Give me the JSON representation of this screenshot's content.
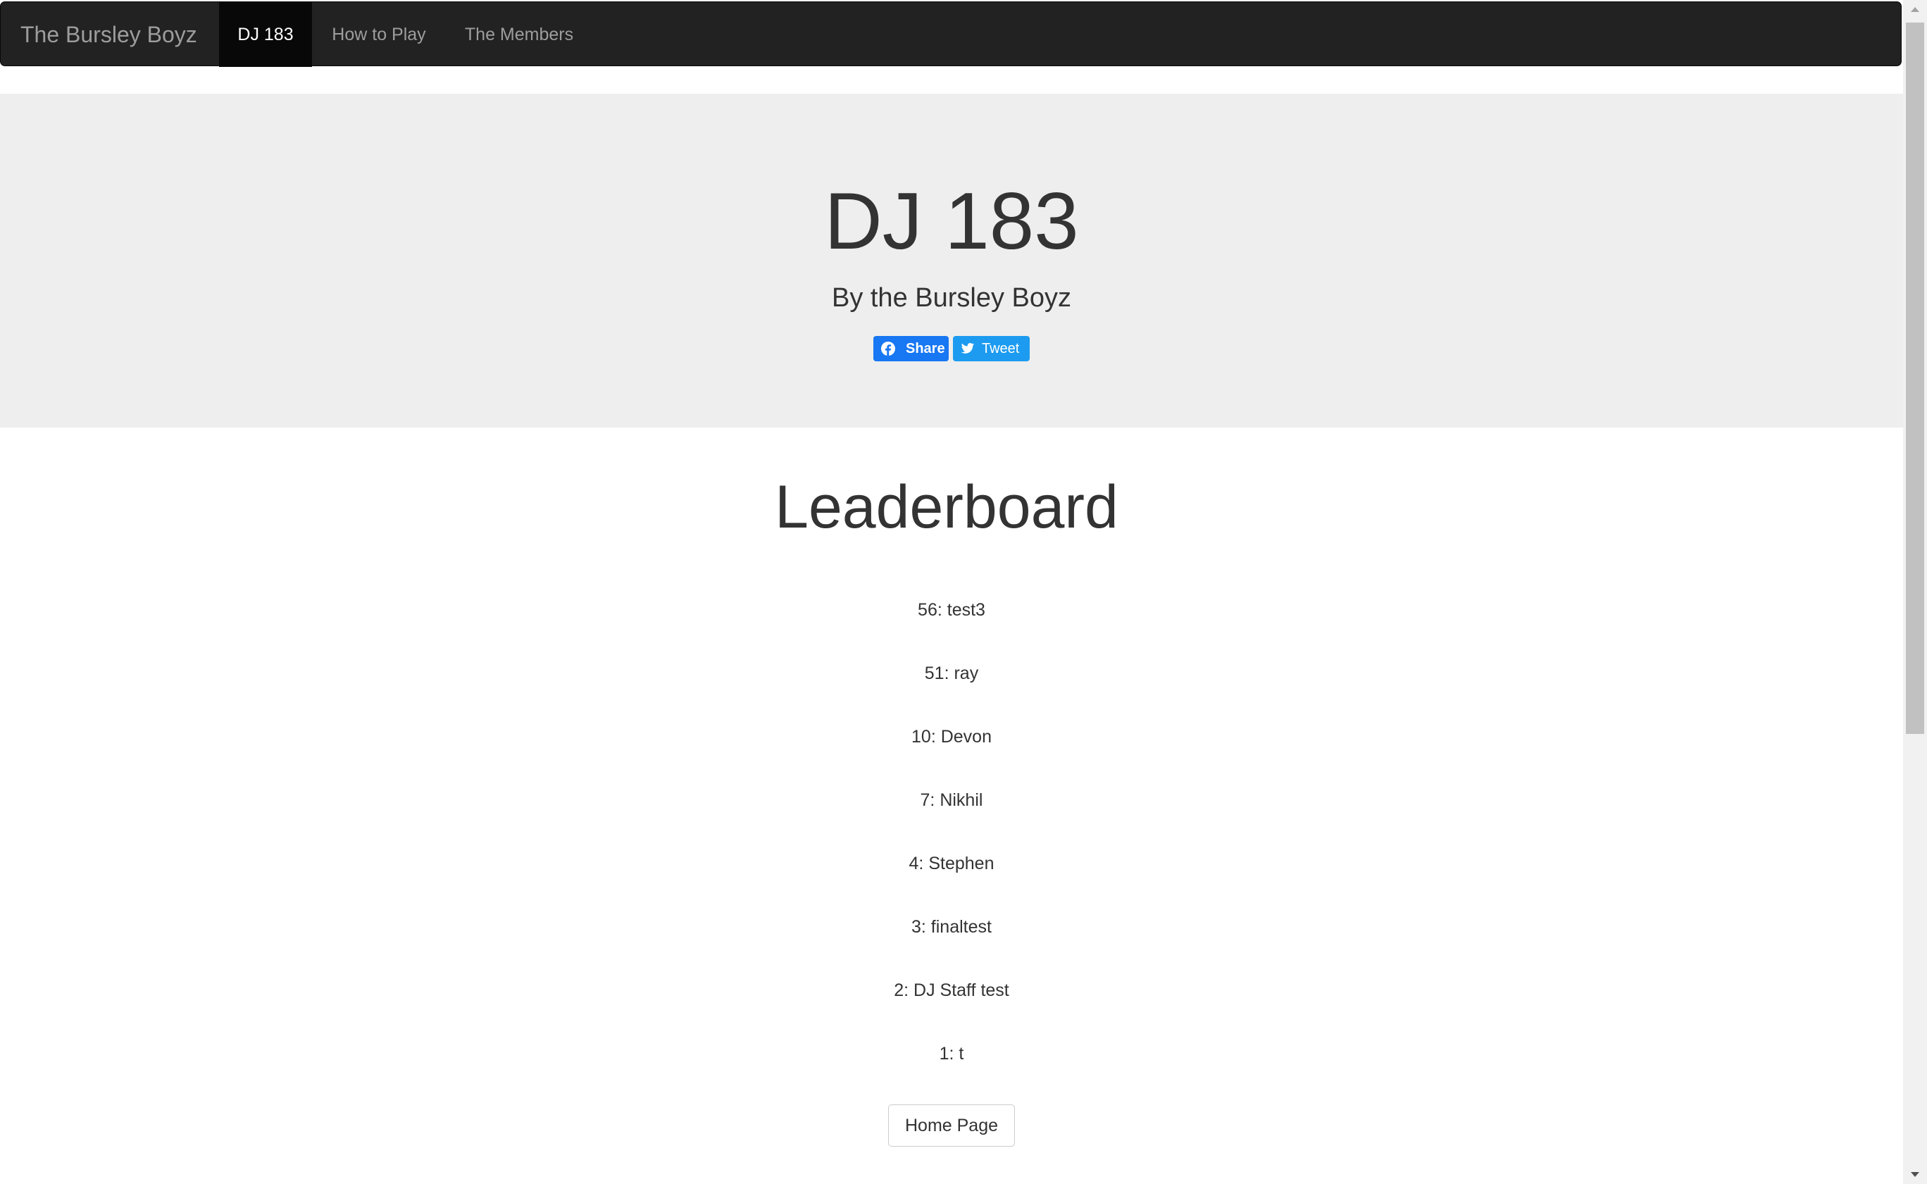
{
  "navbar": {
    "brand": "The Bursley Boyz",
    "items": [
      {
        "label": "DJ 183",
        "active": true
      },
      {
        "label": "How to Play",
        "active": false
      },
      {
        "label": "The Members",
        "active": false
      }
    ]
  },
  "hero": {
    "title": "DJ 183",
    "subtitle": "By the Bursley Boyz",
    "share_buttons": {
      "facebook_label": "Share",
      "twitter_label": "Tweet"
    }
  },
  "leaderboard": {
    "title": "Leaderboard",
    "entries": [
      "56: test3",
      "51: ray",
      "10: Devon",
      "7: Nikhil",
      "4: Stephen",
      "3: finaltest",
      "2: DJ Staff test",
      "1: t"
    ],
    "home_button_label": "Home Page"
  },
  "colors": {
    "navbar_bg": "#222222",
    "navbar_active_bg": "#080808",
    "jumbotron_bg": "#eeeeee",
    "facebook_blue": "#1877f2",
    "twitter_blue": "#1d9bf0",
    "text": "#333333"
  },
  "icons": {
    "facebook": "facebook-icon",
    "twitter": "twitter-icon"
  }
}
